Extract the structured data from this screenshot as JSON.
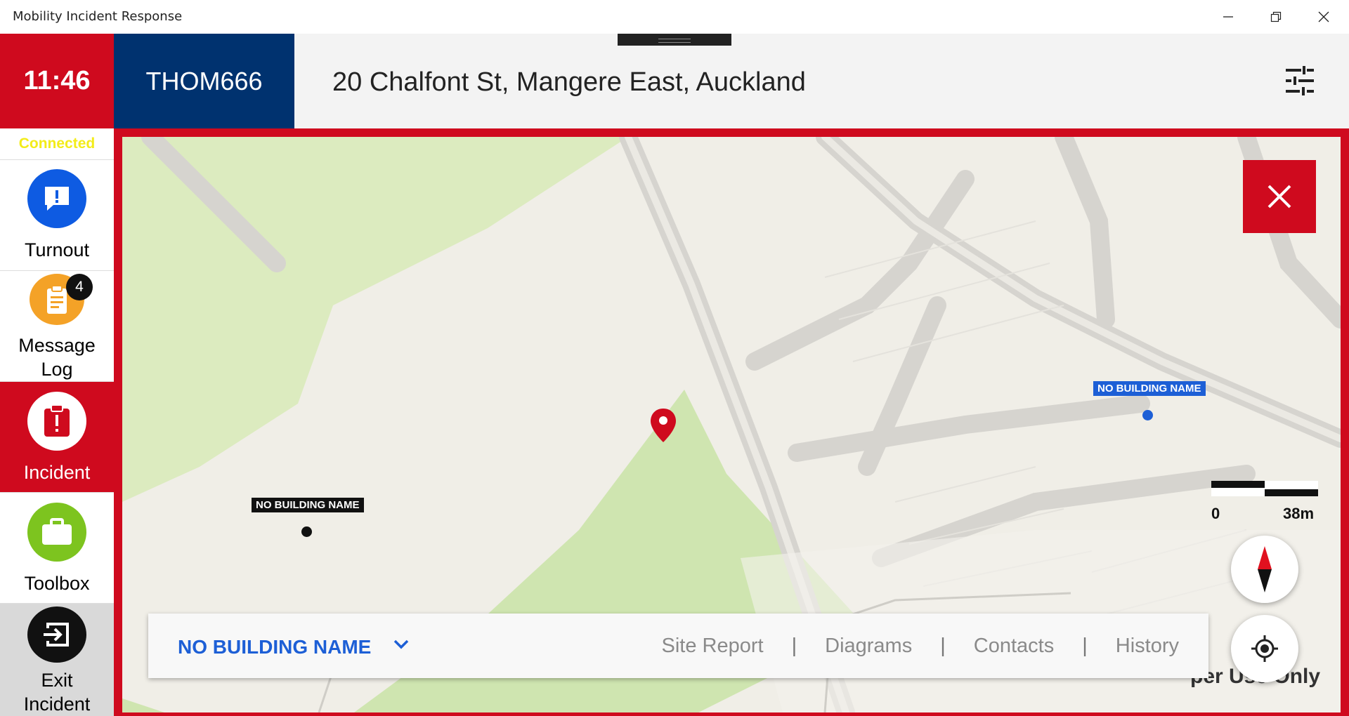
{
  "window": {
    "title": "Mobility Incident Response",
    "controls": [
      "minimize-icon",
      "restore-icon",
      "close-icon"
    ]
  },
  "header": {
    "time": "11:46",
    "callsign": "THOM666",
    "address": "20 Chalfont St, Mangere East, Auckland",
    "filter_icon": "sliders-icon"
  },
  "sidebar": {
    "status": "Connected",
    "items": [
      {
        "label": "Turnout",
        "icon": "alert-message-icon",
        "color": "#0e5be2"
      },
      {
        "label": "Message Log",
        "icon": "clipboard-icon",
        "color": "#f4a227",
        "badge": "4"
      },
      {
        "label": "Incident",
        "icon": "incident-clipboard-icon",
        "color": "#cf0a1e",
        "active": true
      },
      {
        "label": "Toolbox",
        "icon": "briefcase-icon",
        "color": "#7dc41f"
      },
      {
        "label": "Exit Incident",
        "icon": "exit-icon",
        "color": "#111111"
      }
    ]
  },
  "map": {
    "buildings": [
      {
        "label": "NO BUILDING NAME",
        "color": "#1d5fd6"
      },
      {
        "label": "NO BUILDING NAME",
        "color": "#111111"
      }
    ],
    "scale": {
      "start": "0",
      "end": "38m"
    },
    "watermark": "per Use Only",
    "close_icon": "close-icon",
    "compass_icon": "compass-icon",
    "locate_icon": "locate-icon",
    "incident_marker": "map-pin-icon"
  },
  "bottom_bar": {
    "selected_building": "NO BUILDING NAME",
    "tabs": [
      "Site Report",
      "Diagrams",
      "Contacts",
      "History"
    ],
    "separator": "|"
  },
  "colors": {
    "accent_red": "#cf0a1e",
    "navy": "#00326f",
    "link_blue": "#1d5fd6",
    "connected_yellow": "#f3ec19"
  }
}
